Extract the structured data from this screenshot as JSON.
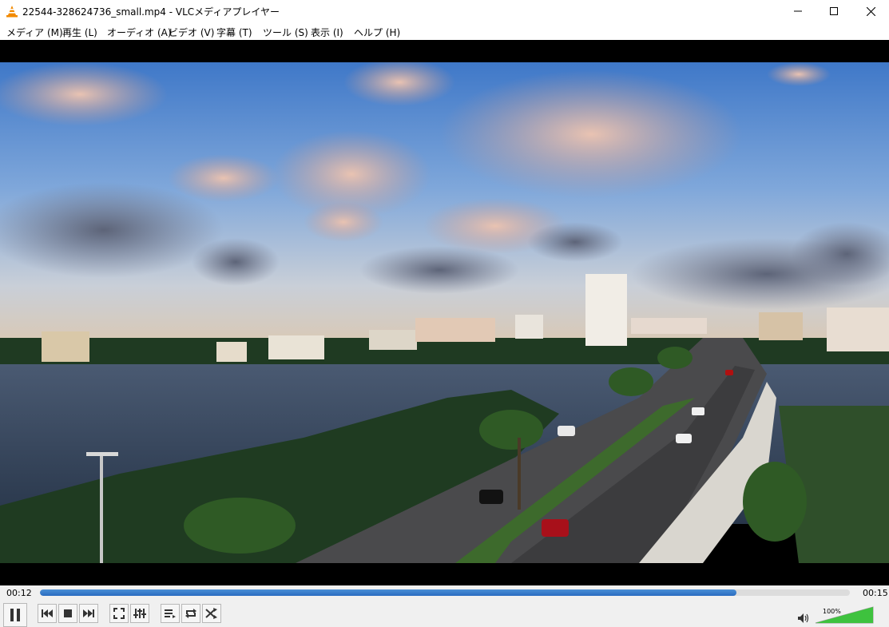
{
  "window": {
    "title": "22544-328624736_small.mp4 - VLCメディアプレイヤー"
  },
  "menu": [
    {
      "label": "メディア (M)"
    },
    {
      "label": "再生 (L)"
    },
    {
      "label": "オーディオ (A)"
    },
    {
      "label": "ビデオ (V)"
    },
    {
      "label": "字幕 (T)"
    },
    {
      "label": "ツール (S)"
    },
    {
      "label": "表示 (I)"
    },
    {
      "label": "ヘルプ (H)"
    }
  ],
  "playback": {
    "elapsed": "00:12",
    "total": "00:15",
    "progress": 0.86
  },
  "volume": {
    "label": "100%",
    "level": 1.0
  },
  "colors": {
    "accent": "#2a6cc0",
    "volume": "#3ec23e",
    "vlc_orange": "#f28a00"
  },
  "icons": {
    "app": "vlc-cone-icon",
    "minimize": "minimize-icon",
    "maximize": "maximize-icon",
    "close": "close-icon",
    "pause": "pause-icon",
    "previous": "previous-icon",
    "stop": "stop-icon",
    "next": "next-icon",
    "fullscreen": "fullscreen-icon",
    "extended": "extended-settings-icon",
    "playlist": "playlist-icon",
    "loop": "loop-icon",
    "shuffle": "shuffle-icon",
    "speaker": "speaker-icon"
  }
}
